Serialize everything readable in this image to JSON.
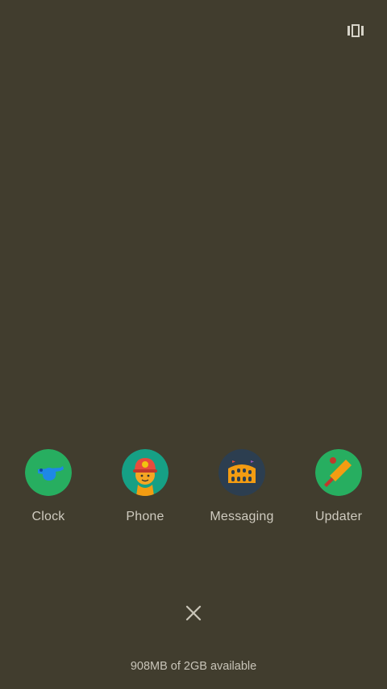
{
  "recents": {
    "apps": [
      {
        "label": "Clock",
        "icon": "whistle-icon",
        "color": "#27ae60"
      },
      {
        "label": "Phone",
        "icon": "firefighter-icon",
        "color": "#16a085"
      },
      {
        "label": "Messaging",
        "icon": "colosseum-icon",
        "color": "#2c3e50"
      },
      {
        "label": "Updater",
        "icon": "cricket-bat-icon",
        "color": "#27ae60"
      }
    ],
    "storage_text": "908MB of 2GB available",
    "top_right_icon": "multi-window-icon",
    "close_icon": "close-icon"
  },
  "colors": {
    "background": "#413d2e",
    "label_text": "#cfcbbf"
  }
}
